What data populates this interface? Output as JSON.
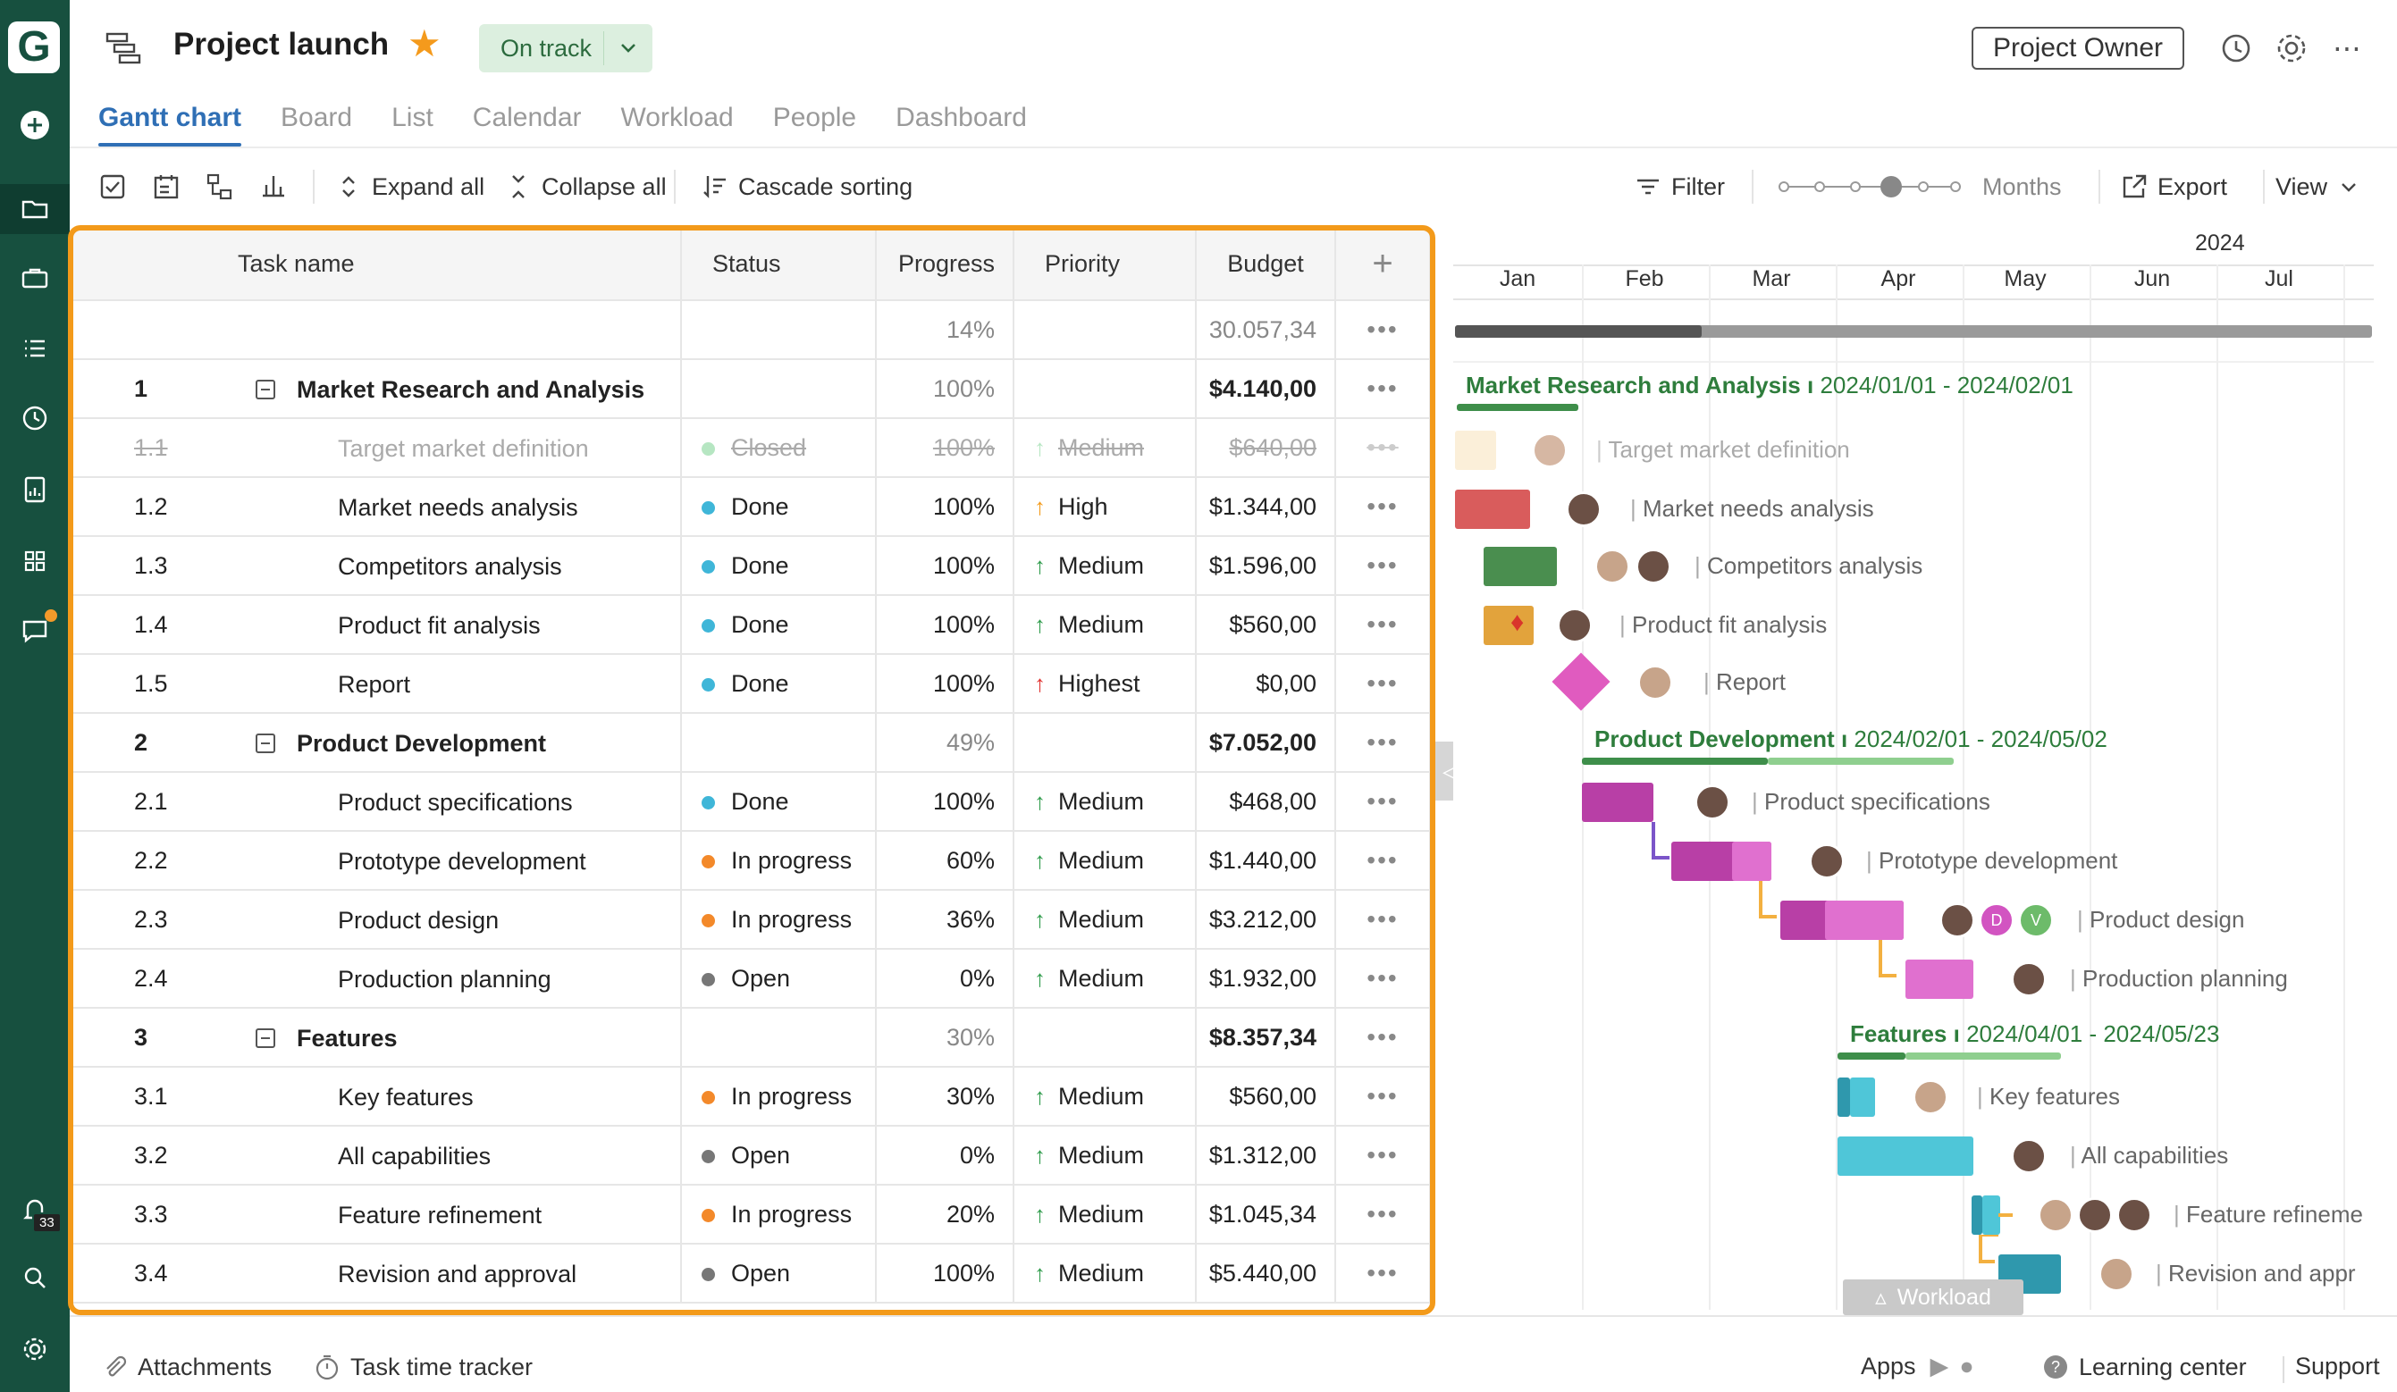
{
  "app": {
    "logo_letter": "G",
    "notifications_count": "33"
  },
  "sidebar": {
    "icons": [
      "add-icon",
      "folder-icon",
      "briefcase-icon",
      "list-icon",
      "clock-icon",
      "report-icon",
      "apps-icon",
      "chat-icon",
      "bell-icon",
      "search-icon",
      "settings-icon"
    ]
  },
  "header": {
    "title": "Project launch",
    "status": "On track",
    "owner_button": "Project Owner"
  },
  "tabs": [
    "Gantt chart",
    "Board",
    "List",
    "Calendar",
    "Workload",
    "People",
    "Dashboard"
  ],
  "toolbar": {
    "expand_all": "Expand all",
    "collapse_all": "Collapse all",
    "cascade_sorting": "Cascade sorting",
    "filter": "Filter",
    "zoom_label": "Months",
    "export": "Export",
    "view": "View"
  },
  "grid": {
    "columns": [
      "Task name",
      "Status",
      "Progress",
      "Priority",
      "Budget"
    ],
    "summary": {
      "progress": "14%",
      "budget": "30.057,34"
    },
    "rows": [
      {
        "num": "1",
        "name": "Market Research and Analysis",
        "group": true,
        "progress": "100%",
        "budget": "$4.140,00"
      },
      {
        "num": "1.1",
        "name": "Target market definition",
        "status": "Closed",
        "status_color": "#b6e6c2",
        "progress": "100%",
        "priority": "Medium",
        "priority_color": "#b6e6c2",
        "budget": "$640,00",
        "closed": true
      },
      {
        "num": "1.2",
        "name": "Market needs analysis",
        "status": "Done",
        "status_color": "#3fb6d8",
        "progress": "100%",
        "priority": "High",
        "priority_color": "#f39a1a",
        "budget": "$1.344,00"
      },
      {
        "num": "1.3",
        "name": "Competitors analysis",
        "status": "Done",
        "status_color": "#3fb6d8",
        "progress": "100%",
        "priority": "Medium",
        "priority_color": "#2e9b4a",
        "budget": "$1.596,00"
      },
      {
        "num": "1.4",
        "name": "Product fit analysis",
        "status": "Done",
        "status_color": "#3fb6d8",
        "progress": "100%",
        "priority": "Medium",
        "priority_color": "#2e9b4a",
        "budget": "$560,00"
      },
      {
        "num": "1.5",
        "name": "Report",
        "status": "Done",
        "status_color": "#3fb6d8",
        "progress": "100%",
        "priority": "Highest",
        "priority_color": "#e0312e",
        "budget": "$0,00"
      },
      {
        "num": "2",
        "name": "Product Development",
        "group": true,
        "progress": "49%",
        "budget": "$7.052,00"
      },
      {
        "num": "2.1",
        "name": "Product specifications",
        "status": "Done",
        "status_color": "#3fb6d8",
        "progress": "100%",
        "priority": "Medium",
        "priority_color": "#2e9b4a",
        "budget": "$468,00"
      },
      {
        "num": "2.2",
        "name": "Prototype development",
        "status": "In progress",
        "status_color": "#f3892a",
        "progress": "60%",
        "priority": "Medium",
        "priority_color": "#2e9b4a",
        "budget": "$1.440,00"
      },
      {
        "num": "2.3",
        "name": "Product design",
        "status": "In progress",
        "status_color": "#f3892a",
        "progress": "36%",
        "priority": "Medium",
        "priority_color": "#2e9b4a",
        "budget": "$3.212,00"
      },
      {
        "num": "2.4",
        "name": "Production planning",
        "status": "Open",
        "status_color": "#777777",
        "progress": "0%",
        "priority": "Medium",
        "priority_color": "#2e9b4a",
        "budget": "$1.932,00"
      },
      {
        "num": "3",
        "name": "Features",
        "group": true,
        "progress": "30%",
        "budget": "$8.357,34"
      },
      {
        "num": "3.1",
        "name": "Key features",
        "status": "In progress",
        "status_color": "#f3892a",
        "progress": "30%",
        "priority": "Medium",
        "priority_color": "#2e9b4a",
        "budget": "$560,00"
      },
      {
        "num": "3.2",
        "name": "All capabilities",
        "status": "Open",
        "status_color": "#777777",
        "progress": "0%",
        "priority": "Medium",
        "priority_color": "#2e9b4a",
        "budget": "$1.312,00"
      },
      {
        "num": "3.3",
        "name": "Feature refinement",
        "status": "In progress",
        "status_color": "#f3892a",
        "progress": "20%",
        "priority": "Medium",
        "priority_color": "#2e9b4a",
        "budget": "$1.045,34"
      },
      {
        "num": "3.4",
        "name": "Revision and approval",
        "status": "Open",
        "status_color": "#777777",
        "progress": "100%",
        "priority": "Medium",
        "priority_color": "#2e9b4a",
        "budget": "$5.440,00"
      }
    ]
  },
  "gantt": {
    "year": "2024",
    "months": [
      "Jan",
      "Feb",
      "Mar",
      "Apr",
      "May",
      "Jun",
      "Jul"
    ],
    "groups": [
      {
        "name": "Market Research and Analysis",
        "dates": "2024/01/01 - 2024/02/01"
      },
      {
        "name": "Product Development",
        "dates": "2024/02/01 - 2024/05/02"
      },
      {
        "name": "Features",
        "dates": "2024/04/01 - 2024/05/23"
      }
    ],
    "task_labels": [
      "Target market definition",
      "Market needs analysis",
      "Competitors analysis",
      "Product fit analysis",
      "Report",
      "Product specifications",
      "Prototype development",
      "Product design",
      "Production planning",
      "Key features",
      "All capabilities",
      "Feature refineme",
      "Revision and appr"
    ],
    "avatar_letters": [
      "D",
      "V"
    ],
    "workload": "Workload"
  },
  "footer": {
    "attachments": "Attachments",
    "time_tracker": "Task time tracker",
    "apps": "Apps",
    "learning_center": "Learning center",
    "support": "Support"
  }
}
